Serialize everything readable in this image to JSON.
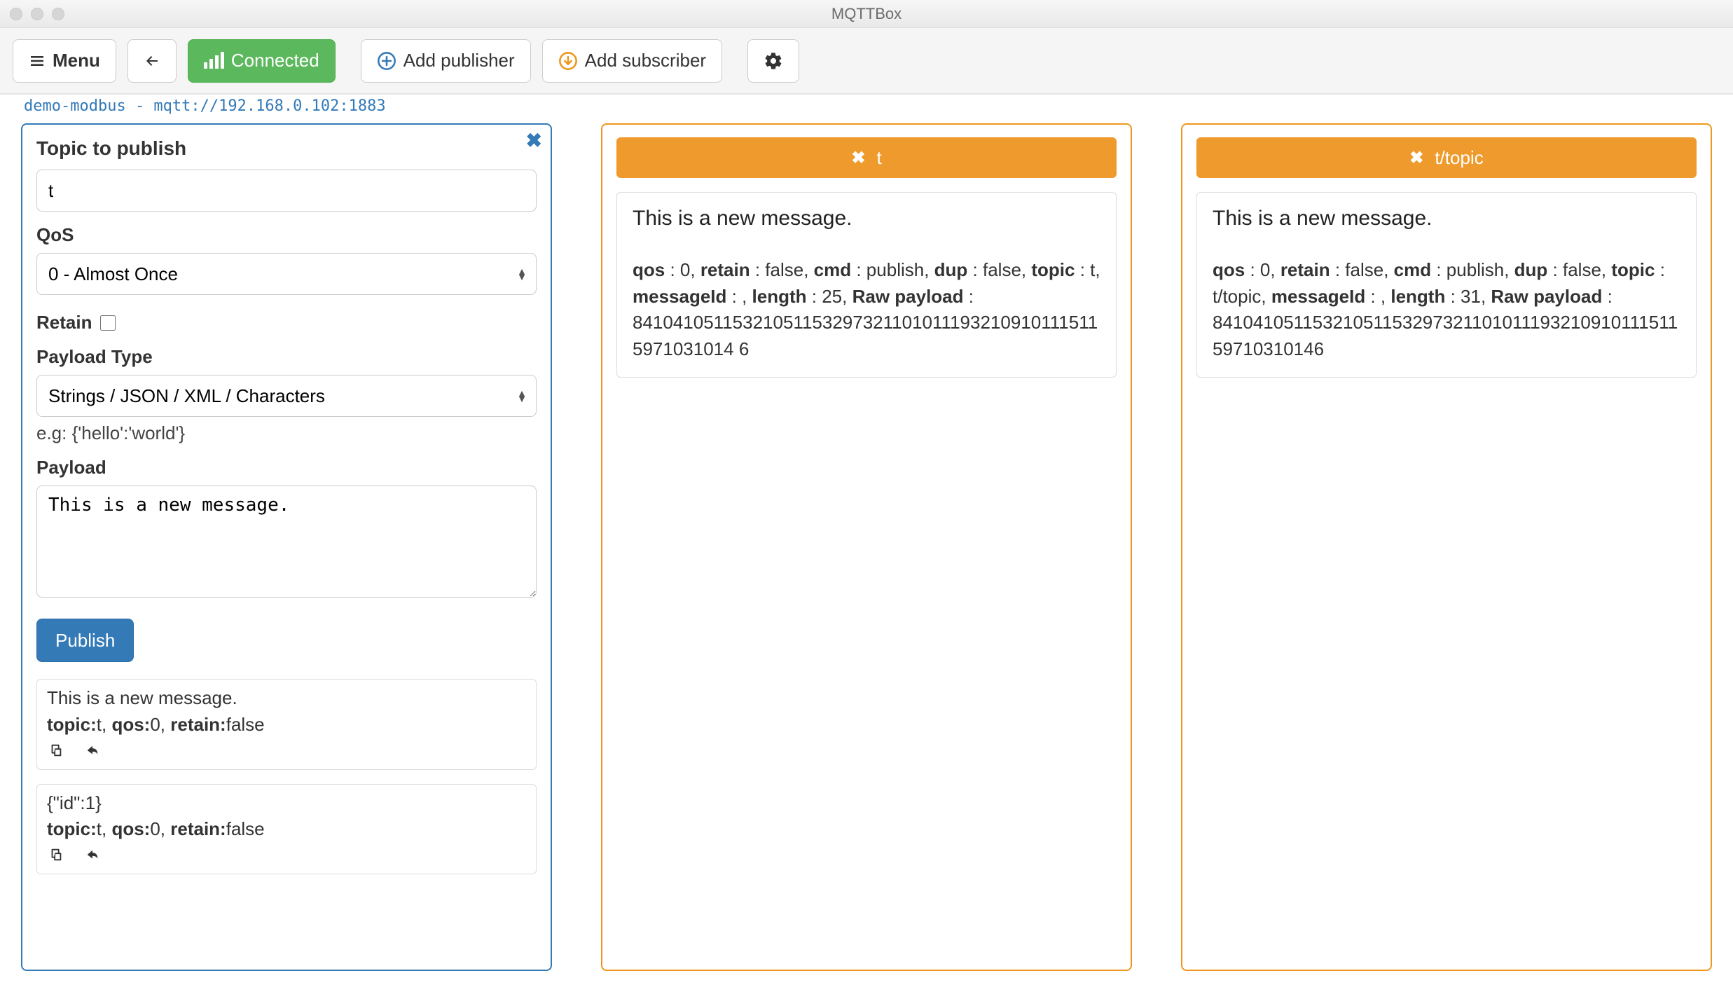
{
  "window": {
    "title": "MQTTBox"
  },
  "toolbar": {
    "menu_label": "Menu",
    "connected_label": "Connected",
    "add_publisher_label": "Add publisher",
    "add_subscriber_label": "Add subscriber"
  },
  "connection": {
    "line": "demo-modbus - mqtt://192.168.0.102:1883"
  },
  "publisher": {
    "title": "Topic to publish",
    "topic_value": "t",
    "qos_label": "QoS",
    "qos_value": "0 - Almost Once",
    "retain_label": "Retain",
    "retain_checked": false,
    "payload_type_label": "Payload Type",
    "payload_type_value": "Strings / JSON / XML / Characters",
    "payload_type_hint": "e.g: {'hello':'world'}",
    "payload_label": "Payload",
    "payload_value": "This is a new message.",
    "publish_label": "Publish",
    "history": [
      {
        "body": "This is a new message.",
        "meta_html": "<b>topic:</b>t, <b>qos:</b>0, <b>retain:</b>false"
      },
      {
        "body": "{\"id\":1}",
        "meta_html": "<b>topic:</b>t, <b>qos:</b>0, <b>retain:</b>false"
      }
    ]
  },
  "subscribers": [
    {
      "topic": "t",
      "message": {
        "body": "This is a new message.",
        "qos": 0,
        "retain": "false",
        "cmd": "publish",
        "dup": "false",
        "topic": "t",
        "messageId": "",
        "length": 25,
        "raw_payload": "841041051153210511532973211010111932109101115115971031014 6"
      }
    },
    {
      "topic": "t/topic",
      "message": {
        "body": "This is a new message.",
        "qos": 0,
        "retain": "false",
        "cmd": "publish",
        "dup": "false",
        "topic": "t/topic",
        "messageId": "",
        "length": 31,
        "raw_payload": "8410410511532105115329732110101119321091011151159710310146"
      }
    }
  ],
  "colors": {
    "primary": "#337ab7",
    "success": "#5cb85c",
    "subscriber": "#ef971c"
  }
}
